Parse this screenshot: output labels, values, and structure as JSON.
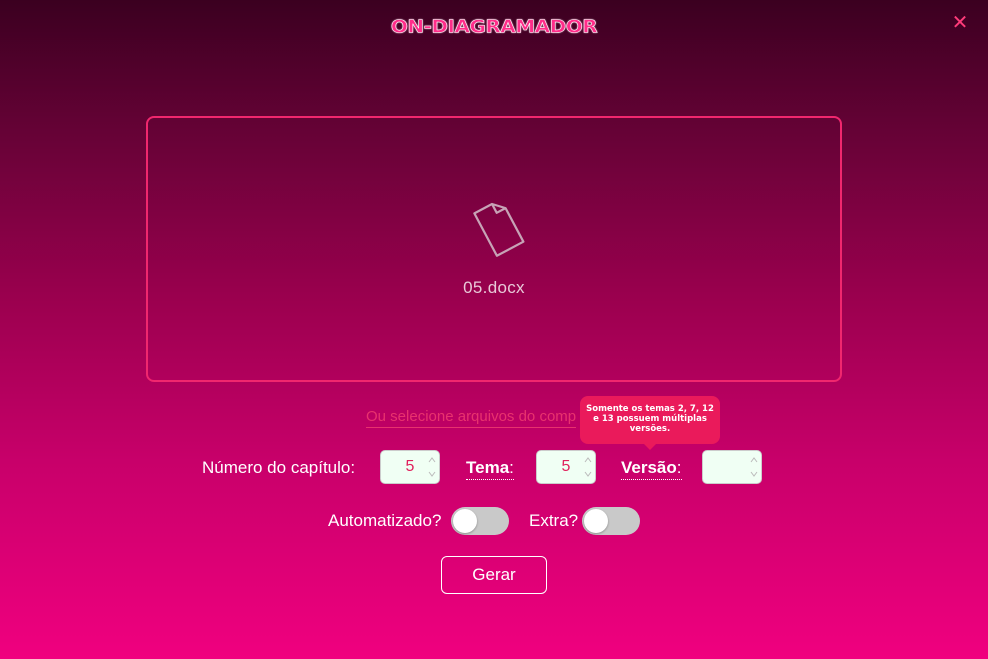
{
  "app": {
    "title": "ON-DIAGRAMADOR",
    "close_icon": "close-icon"
  },
  "dropzone": {
    "file_icon": "document-icon",
    "file_name": "05.docx"
  },
  "select_link": "Ou selecione arquivos do comp",
  "tooltip": "Somente os temas 2, 7, 12 e 13 possuem múltiplas versões.",
  "fields": {
    "chapter_label": "Número do capítulo:",
    "chapter_value": "5",
    "tema_label": "Tema",
    "tema_value": "5",
    "versao_label": "Versão",
    "versao_value": "",
    "colon": ":"
  },
  "toggles": {
    "automatizado_label": "Automatizado?",
    "automatizado_on": false,
    "extra_label": "Extra?",
    "extra_on": false
  },
  "button": {
    "gerar": "Gerar"
  },
  "colors": {
    "accent": "#ea1a5b",
    "border": "#f0276e",
    "input_bg": "#f0fff4"
  }
}
